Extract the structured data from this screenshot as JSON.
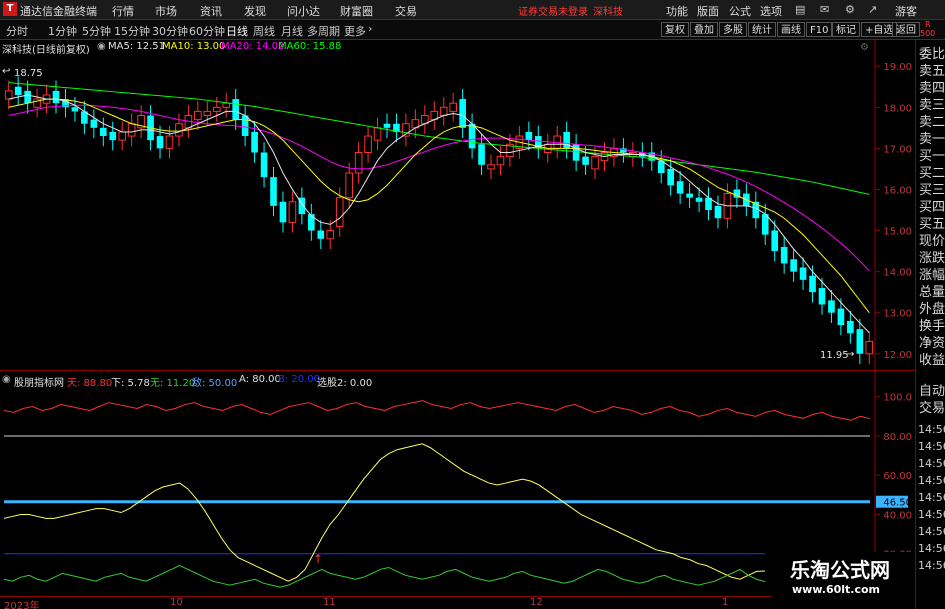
{
  "menubar": {
    "logo": "T",
    "app_title": "通达信金融终端",
    "items": [
      "行情",
      "市场",
      "资讯",
      "发现",
      "问小达",
      "财富圈",
      "交易"
    ],
    "warning": "证券交易未登录",
    "stock_name": "深科技",
    "right_items": [
      "功能",
      "版面",
      "公式",
      "选项"
    ],
    "guest": "游客"
  },
  "periodbar": {
    "periods": [
      "分时",
      "1分钟",
      "5分钟",
      "15分钟",
      "30分钟",
      "60分钟",
      "日线",
      "周线",
      "月线",
      "多周期",
      "更多"
    ],
    "active": "日线",
    "tools": [
      "复权",
      "叠加",
      "多股",
      "统计",
      "画线",
      "F10",
      "标记",
      "+自选",
      "返回"
    ],
    "corner_r": "R",
    "corner_num": "500"
  },
  "infobar": {
    "title": "深科技(日线前复权)",
    "ma5": "MA5: 12.51",
    "ma10": "MA10: 13.00",
    "ma20": "MA20: 14.02",
    "ma60": "MA60: 15.88"
  },
  "indicator_bar": {
    "name": "股朋指标网",
    "tian": "天: 88.80",
    "xia": "下: 5.78",
    "wu": "无: 11.20",
    "di": "敌: 50.00",
    "a": "A: 80.00",
    "b": "B: 20.00",
    "xuangu": "选股2: 0.00"
  },
  "right_panel": {
    "labels": [
      "委比",
      "卖五",
      "卖四",
      "卖三",
      "卖二",
      "卖一",
      "买一",
      "买二",
      "买三",
      "买四",
      "买五",
      "现价",
      "涨跌",
      "涨幅",
      "总量",
      "外盘",
      "换手",
      "净资",
      "收益"
    ],
    "lower_labels": [
      "自动",
      "交易"
    ],
    "times": [
      "14:56",
      "14:56",
      "14:56",
      "14:56",
      "14:56",
      "14:56",
      "14:56",
      "14:56",
      "14:56"
    ]
  },
  "main_axis": [
    "19.00",
    "18.00",
    "17.00",
    "16.00",
    "15.00",
    "14.00",
    "13.00",
    "12.00"
  ],
  "sub_axis": [
    "100.0",
    "80.00",
    "60.00",
    "46.50",
    "40.00",
    "20.00"
  ],
  "x_labels": [
    "2023年",
    "10",
    "11",
    "12",
    "1"
  ],
  "annotations": {
    "high": "18.75",
    "low": "11.95"
  },
  "watermark": {
    "brand": "乐淘公式网",
    "url": "www.60lt.com"
  },
  "colors": {
    "up": "#ff3030",
    "down": "#00ffff",
    "ma5": "#e6e6e6",
    "ma10": "#ffff00",
    "ma20": "#ff00ff",
    "ma60": "#00ff00",
    "line_tian": "#ff3030",
    "line_yellow": "#ffff66",
    "line_green": "#33cc33",
    "level_blue": "#3ab4ff",
    "level_navy": "#2233ff"
  },
  "chart_data": [
    {
      "type": "candlestick",
      "title": "深科技(日线前复权)",
      "ylim": [
        11.8,
        19.2
      ],
      "series": [
        {
          "name": "MA5",
          "value": 12.51
        },
        {
          "name": "MA10",
          "value": 13.0
        },
        {
          "name": "MA20",
          "value": 14.02
        },
        {
          "name": "MA60",
          "value": 15.88
        }
      ],
      "close": [
        18.4,
        18.3,
        18.1,
        18.2,
        18.3,
        18.1,
        18.0,
        17.9,
        17.6,
        17.5,
        17.3,
        17.2,
        17.4,
        17.6,
        17.8,
        17.2,
        17.0,
        17.3,
        17.6,
        17.8,
        17.9,
        17.9,
        18.0,
        18.1,
        17.7,
        17.3,
        16.9,
        16.3,
        15.6,
        15.2,
        15.7,
        15.4,
        15.0,
        14.8,
        15.0,
        15.8,
        16.4,
        16.9,
        17.3,
        17.5,
        17.5,
        17.4,
        17.6,
        17.7,
        17.8,
        17.9,
        18.0,
        18.1,
        17.5,
        17.0,
        16.6,
        16.6,
        16.8,
        17.1,
        17.3,
        17.2,
        17.0,
        17.1,
        17.3,
        17.0,
        16.7,
        16.6,
        16.8,
        16.9,
        17.0,
        16.9,
        16.9,
        16.8,
        16.7,
        16.4,
        16.1,
        15.9,
        15.8,
        15.7,
        15.5,
        15.3,
        15.9,
        15.8,
        15.6,
        15.3,
        14.9,
        14.5,
        14.2,
        14.0,
        13.8,
        13.5,
        13.2,
        13.0,
        12.7,
        12.5,
        12.0,
        12.3
      ],
      "open": [
        18.2,
        18.5,
        18.4,
        18.0,
        18.1,
        18.4,
        18.2,
        18.0,
        17.9,
        17.7,
        17.5,
        17.4,
        17.2,
        17.3,
        17.5,
        17.8,
        17.3,
        17.0,
        17.3,
        17.5,
        17.7,
        17.8,
        17.9,
        18.0,
        18.2,
        17.8,
        17.4,
        16.9,
        16.3,
        15.7,
        15.2,
        15.8,
        15.4,
        15.0,
        14.8,
        15.1,
        15.8,
        16.4,
        16.9,
        17.2,
        17.6,
        17.6,
        17.3,
        17.5,
        17.6,
        17.7,
        17.8,
        17.9,
        18.2,
        17.6,
        17.1,
        16.5,
        16.6,
        16.8,
        17.0,
        17.4,
        17.3,
        16.9,
        17.0,
        17.4,
        17.1,
        16.8,
        16.5,
        16.7,
        16.8,
        17.0,
        16.8,
        16.9,
        16.9,
        16.7,
        16.5,
        16.2,
        15.9,
        15.8,
        15.8,
        15.6,
        15.3,
        16.0,
        15.9,
        15.7,
        15.4,
        15.0,
        14.6,
        14.3,
        14.1,
        13.9,
        13.6,
        13.3,
        13.1,
        12.8,
        12.6,
        12.0
      ],
      "ma5": [
        18.2,
        18.25,
        18.3,
        18.25,
        18.2,
        18.2,
        18.15,
        18.05,
        17.9,
        17.75,
        17.6,
        17.5,
        17.4,
        17.4,
        17.45,
        17.45,
        17.4,
        17.35,
        17.4,
        17.5,
        17.6,
        17.7,
        17.8,
        17.9,
        17.9,
        17.8,
        17.6,
        17.3,
        16.9,
        16.4,
        16.0,
        15.65,
        15.35,
        15.2,
        15.15,
        15.3,
        15.55,
        15.9,
        16.3,
        16.7,
        17.0,
        17.2,
        17.35,
        17.5,
        17.6,
        17.7,
        17.8,
        17.85,
        17.8,
        17.6,
        17.35,
        17.1,
        16.9,
        16.9,
        16.95,
        17.0,
        17.05,
        17.1,
        17.1,
        17.1,
        17.0,
        16.9,
        16.85,
        16.8,
        16.85,
        16.85,
        16.85,
        16.85,
        16.8,
        16.7,
        16.55,
        16.4,
        16.2,
        16.0,
        15.8,
        15.65,
        15.6,
        15.6,
        15.6,
        15.55,
        15.4,
        15.15,
        14.85,
        14.55,
        14.3,
        14.0,
        13.75,
        13.5,
        13.25,
        13.0,
        12.75,
        12.51
      ],
      "ma10": [
        18.0,
        18.05,
        18.1,
        18.15,
        18.2,
        18.2,
        18.18,
        18.15,
        18.1,
        18.0,
        17.9,
        17.8,
        17.7,
        17.6,
        17.55,
        17.5,
        17.45,
        17.42,
        17.42,
        17.45,
        17.5,
        17.55,
        17.6,
        17.65,
        17.7,
        17.7,
        17.65,
        17.55,
        17.4,
        17.2,
        16.95,
        16.7,
        16.45,
        16.2,
        16.0,
        15.85,
        15.75,
        15.7,
        15.75,
        15.9,
        16.1,
        16.35,
        16.6,
        16.85,
        17.05,
        17.25,
        17.4,
        17.5,
        17.55,
        17.55,
        17.5,
        17.4,
        17.3,
        17.2,
        17.15,
        17.1,
        17.05,
        17.0,
        17.0,
        17.0,
        17.0,
        16.98,
        16.95,
        16.92,
        16.9,
        16.88,
        16.86,
        16.84,
        16.8,
        16.75,
        16.7,
        16.6,
        16.5,
        16.35,
        16.2,
        16.05,
        15.95,
        15.85,
        15.75,
        15.65,
        15.55,
        15.45,
        15.3,
        15.1,
        14.9,
        14.65,
        14.4,
        14.15,
        13.9,
        13.6,
        13.3,
        13.0
      ],
      "ma20": [
        17.8,
        17.85,
        17.9,
        17.95,
        18.0,
        18.02,
        18.04,
        18.05,
        18.05,
        18.04,
        18.02,
        18.0,
        17.97,
        17.94,
        17.9,
        17.85,
        17.8,
        17.75,
        17.7,
        17.66,
        17.63,
        17.6,
        17.58,
        17.56,
        17.55,
        17.52,
        17.48,
        17.42,
        17.35,
        17.26,
        17.16,
        17.05,
        16.93,
        16.8,
        16.68,
        16.58,
        16.52,
        16.5,
        16.5,
        16.55,
        16.6,
        16.68,
        16.76,
        16.84,
        16.92,
        17.0,
        17.07,
        17.13,
        17.18,
        17.22,
        17.24,
        17.25,
        17.25,
        17.24,
        17.22,
        17.2,
        17.18,
        17.16,
        17.14,
        17.12,
        17.1,
        17.08,
        17.06,
        17.03,
        17.0,
        16.97,
        16.94,
        16.9,
        16.86,
        16.82,
        16.77,
        16.72,
        16.66,
        16.6,
        16.53,
        16.45,
        16.37,
        16.28,
        16.18,
        16.07,
        15.95,
        15.82,
        15.68,
        15.54,
        15.39,
        15.23,
        15.06,
        14.88,
        14.69,
        14.49,
        14.26,
        14.02
      ],
      "ma60": [
        18.6,
        18.58,
        18.56,
        18.54,
        18.52,
        18.5,
        18.48,
        18.46,
        18.44,
        18.42,
        18.4,
        18.38,
        18.36,
        18.34,
        18.32,
        18.3,
        18.28,
        18.26,
        18.24,
        18.22,
        18.2,
        18.17,
        18.14,
        18.11,
        18.08,
        18.05,
        18.02,
        17.98,
        17.94,
        17.9,
        17.86,
        17.82,
        17.78,
        17.74,
        17.7,
        17.66,
        17.62,
        17.58,
        17.54,
        17.5,
        17.46,
        17.42,
        17.38,
        17.34,
        17.3,
        17.27,
        17.24,
        17.21,
        17.18,
        17.15,
        17.12,
        17.1,
        17.08,
        17.06,
        17.04,
        17.02,
        17.0,
        16.98,
        16.96,
        16.94,
        16.92,
        16.9,
        16.88,
        16.86,
        16.84,
        16.82,
        16.8,
        16.78,
        16.75,
        16.72,
        16.69,
        16.66,
        16.63,
        16.6,
        16.57,
        16.54,
        16.51,
        16.48,
        16.45,
        16.42,
        16.38,
        16.34,
        16.3,
        16.26,
        16.22,
        16.18,
        16.13,
        16.08,
        16.03,
        15.98,
        15.93,
        15.88
      ]
    },
    {
      "type": "line",
      "title": "股朋指标网",
      "ylim": [
        0,
        108
      ],
      "levels": [
        {
          "name": "A",
          "value": 80.0
        },
        {
          "name": "46.50",
          "value": 46.5
        },
        {
          "name": "B",
          "value": 20.0
        }
      ],
      "series": [
        {
          "name": "天",
          "values": [
            93,
            92,
            94,
            95,
            93,
            94,
            96,
            95,
            94,
            93,
            95,
            97,
            96,
            95,
            94,
            96,
            95,
            93,
            94,
            96,
            97,
            95,
            94,
            93,
            95,
            96,
            94,
            92,
            91,
            93,
            95,
            96,
            97,
            95,
            93,
            94,
            96,
            97,
            95,
            94,
            93,
            95,
            96,
            97,
            98,
            96,
            95,
            94,
            96,
            97,
            95,
            94,
            95,
            96,
            97,
            96,
            95,
            94,
            93,
            95,
            96,
            94,
            92,
            93,
            95,
            94,
            93,
            91,
            92,
            94,
            95,
            93,
            92,
            90,
            91,
            93,
            94,
            92,
            91,
            90,
            92,
            93,
            91,
            90,
            89,
            91,
            92,
            90,
            89,
            88,
            90,
            88.8
          ]
        },
        {
          "name": "下",
          "values": [
            7,
            6,
            8,
            9,
            7,
            6,
            8,
            10,
            9,
            8,
            7,
            6,
            8,
            9,
            10,
            8,
            7,
            6,
            8,
            10,
            12,
            14,
            12,
            10,
            8,
            6,
            5,
            4,
            5,
            6,
            7,
            5,
            4,
            3,
            4,
            6,
            8,
            10,
            12,
            10,
            9,
            8,
            7,
            8,
            10,
            12,
            13,
            11,
            9,
            8,
            7,
            8,
            9,
            11,
            12,
            10,
            8,
            7,
            6,
            7,
            8,
            10,
            11,
            9,
            8,
            7,
            6,
            5,
            6,
            8,
            10,
            12,
            11,
            9,
            7,
            6,
            5,
            6,
            8,
            9,
            7,
            6,
            5,
            4,
            5,
            6,
            8,
            10,
            12,
            9,
            7,
            5.78
          ]
        },
        {
          "name": "无",
          "values": [
            38,
            39,
            40,
            40,
            39,
            38,
            38,
            39,
            40,
            41,
            42,
            43,
            43,
            42,
            41,
            43,
            46,
            49,
            52,
            54,
            55,
            56,
            53,
            48,
            42,
            35,
            28,
            22,
            18,
            16,
            14,
            12,
            10,
            8,
            6,
            8,
            12,
            20,
            28,
            35,
            40,
            46,
            52,
            58,
            63,
            68,
            71,
            73,
            74,
            75,
            76,
            74,
            71,
            68,
            65,
            62,
            60,
            58,
            56,
            55,
            56,
            57,
            58,
            57,
            55,
            52,
            49,
            46,
            43,
            40,
            38,
            36,
            34,
            32,
            30,
            28,
            26,
            24,
            22,
            21,
            20,
            18,
            17,
            15,
            14,
            12,
            10,
            8,
            7,
            9,
            11,
            11.2
          ]
        }
      ]
    }
  ]
}
